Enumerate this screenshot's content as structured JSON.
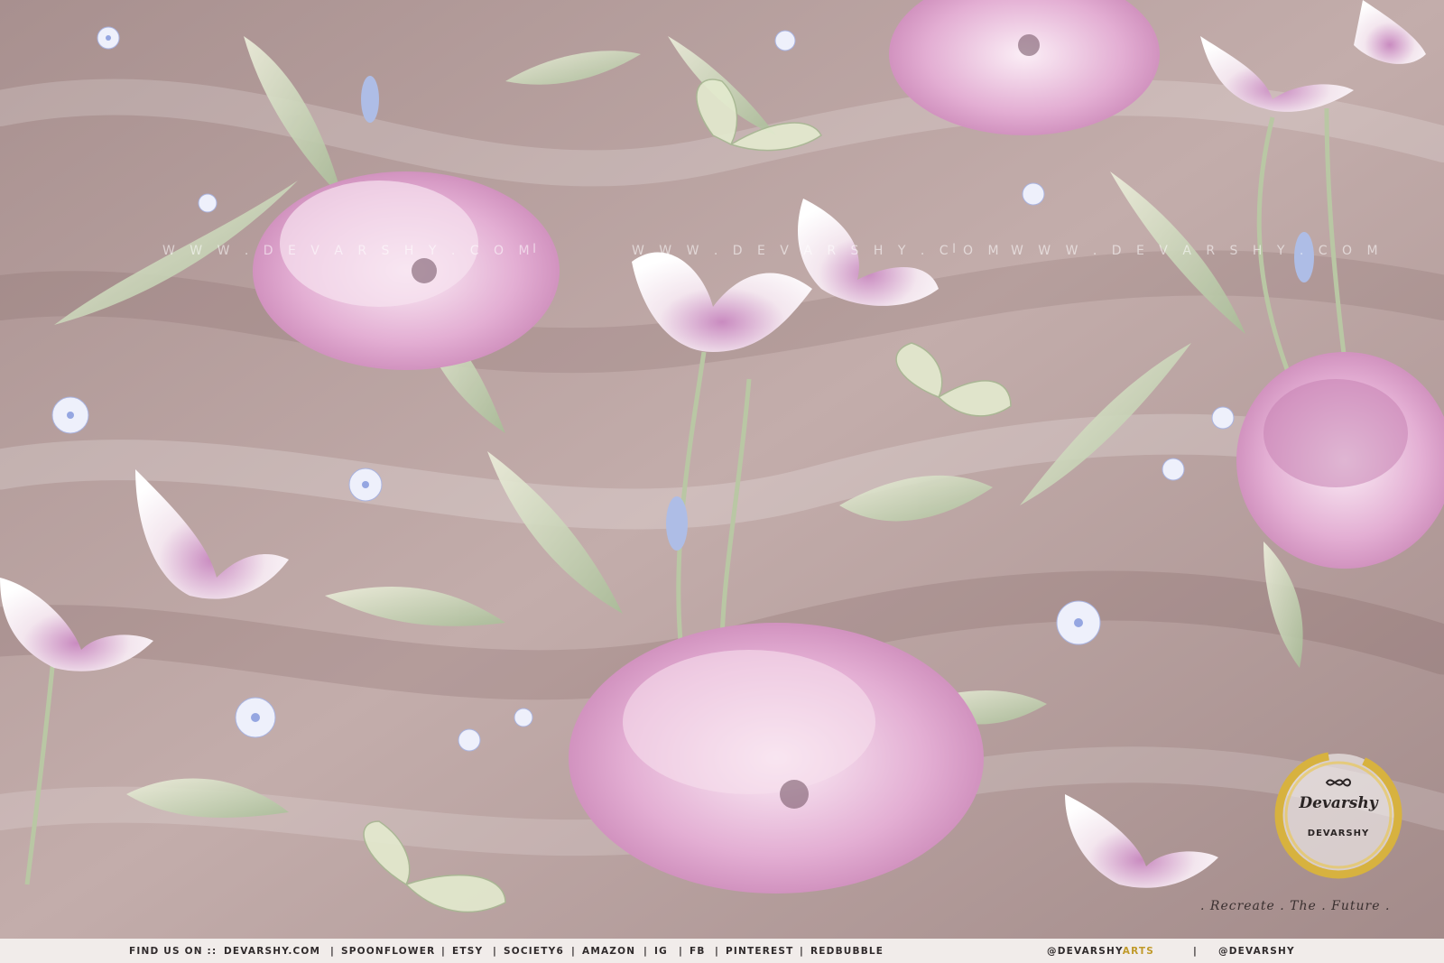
{
  "watermark": {
    "text_1": "W W W . D E V A R S H Y . C O M",
    "text_2": "W W W . D E V A R S H Y . C O M",
    "text_3": "W W W . D E V A R S H Y . C O M",
    "separator": "I"
  },
  "badge": {
    "brand": "Devarshy",
    "name": "DEVARSHY"
  },
  "tagline": ". Recreate . The . Future .",
  "footer": {
    "find_us": "FIND US ON ::",
    "links": [
      "DEVARSHY.COM",
      "SPOONFLOWER",
      "ETSY",
      "SOCIETY6",
      "AMAZON",
      "IG",
      "FB",
      "PINTEREST",
      "REDBUBBLE"
    ],
    "separator": "|",
    "handle_1_prefix": "@DEVARSHY",
    "handle_1_suffix": "ARTS",
    "handle_2": "@DEVARSHY"
  },
  "colors": {
    "fabric": "#b9a3a2",
    "petal": "#d79ac6",
    "leaf": "#c8d3b3",
    "footer_bg": "#f1ecea",
    "gold": "#c09a2a"
  }
}
